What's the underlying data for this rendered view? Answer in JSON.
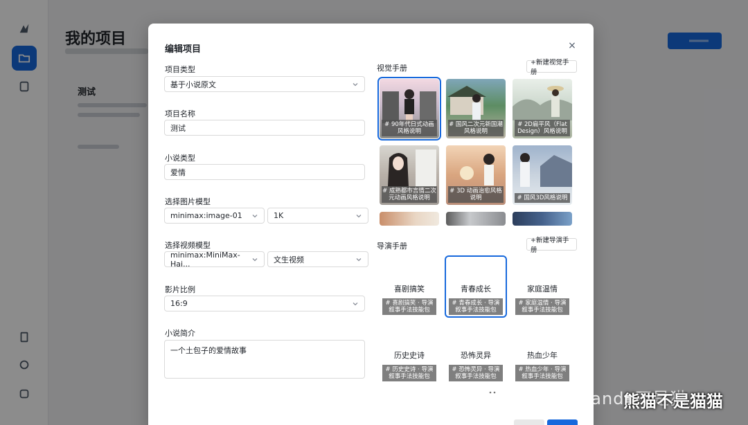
{
  "background": {
    "page_title": "我的项目",
    "card_title": "测试"
  },
  "modal": {
    "title": "编辑项目",
    "close_label": "×",
    "fields": {
      "project_type": {
        "label": "项目类型",
        "value": "基于小说原文"
      },
      "project_name": {
        "label": "项目名称",
        "value": "测试"
      },
      "novel_type": {
        "label": "小说类型",
        "value": "爱情"
      },
      "image_model": {
        "label": "选择图片模型",
        "model": "minimax:image-01",
        "resolution": "1K"
      },
      "video_model": {
        "label": "选择视频模型",
        "model": "minimax:MiniMax-Hai...",
        "mode": "文生视频"
      },
      "aspect_ratio": {
        "label": "影片比例",
        "value": "16:9"
      },
      "synopsis": {
        "label": "小说简介",
        "value": "一个土包子的爱情故事"
      }
    },
    "visual_manual": {
      "label": "视觉手册",
      "new_button": "+新建视觉手册",
      "items": [
        {
          "caption": "# 90年代日式动画风格说明",
          "selected": true
        },
        {
          "caption": "# 国风二次元新国潮风格说明",
          "selected": false
        },
        {
          "caption": "# 2D扁平风（Flat Design）风格说明",
          "selected": false
        },
        {
          "caption": "# 成熟都市言情二次元动画风格说明",
          "selected": false
        },
        {
          "caption": "# 3D 动画治愈风格说明",
          "selected": false
        },
        {
          "caption": "# 国风3D风格说明",
          "selected": false
        }
      ]
    },
    "director_manual": {
      "label": "导演手册",
      "new_button": "+新建导演手册",
      "items": [
        {
          "name": "喜剧搞笑",
          "tag": "# 喜剧搞笑 · 导演叙事手法技能包",
          "selected": false
        },
        {
          "name": "青春成长",
          "tag": "# 青春成长 · 导演叙事手法技能包",
          "selected": true
        },
        {
          "name": "家庭温情",
          "tag": "# 家庭温情 · 导演叙事手法技能包",
          "selected": false
        },
        {
          "name": "历史史诗",
          "tag": "# 历史史诗 · 导演叙事手法技能包",
          "selected": false
        },
        {
          "name": "恐怖灵异",
          "tag": "# 恐怖灵异 · 导演叙事手法技能包",
          "selected": false
        },
        {
          "name": "热血少年",
          "tag": "# 热血少年 · 导演叙事手法技能包",
          "selected": false
        }
      ]
    }
  },
  "watermark": {
    "account": "公众号 · Panda不是猫",
    "badge": "熊猫不是猫猫"
  },
  "colors": {
    "primary": "#1668dc",
    "overlay": "rgba(0,0,0,0.45)"
  }
}
